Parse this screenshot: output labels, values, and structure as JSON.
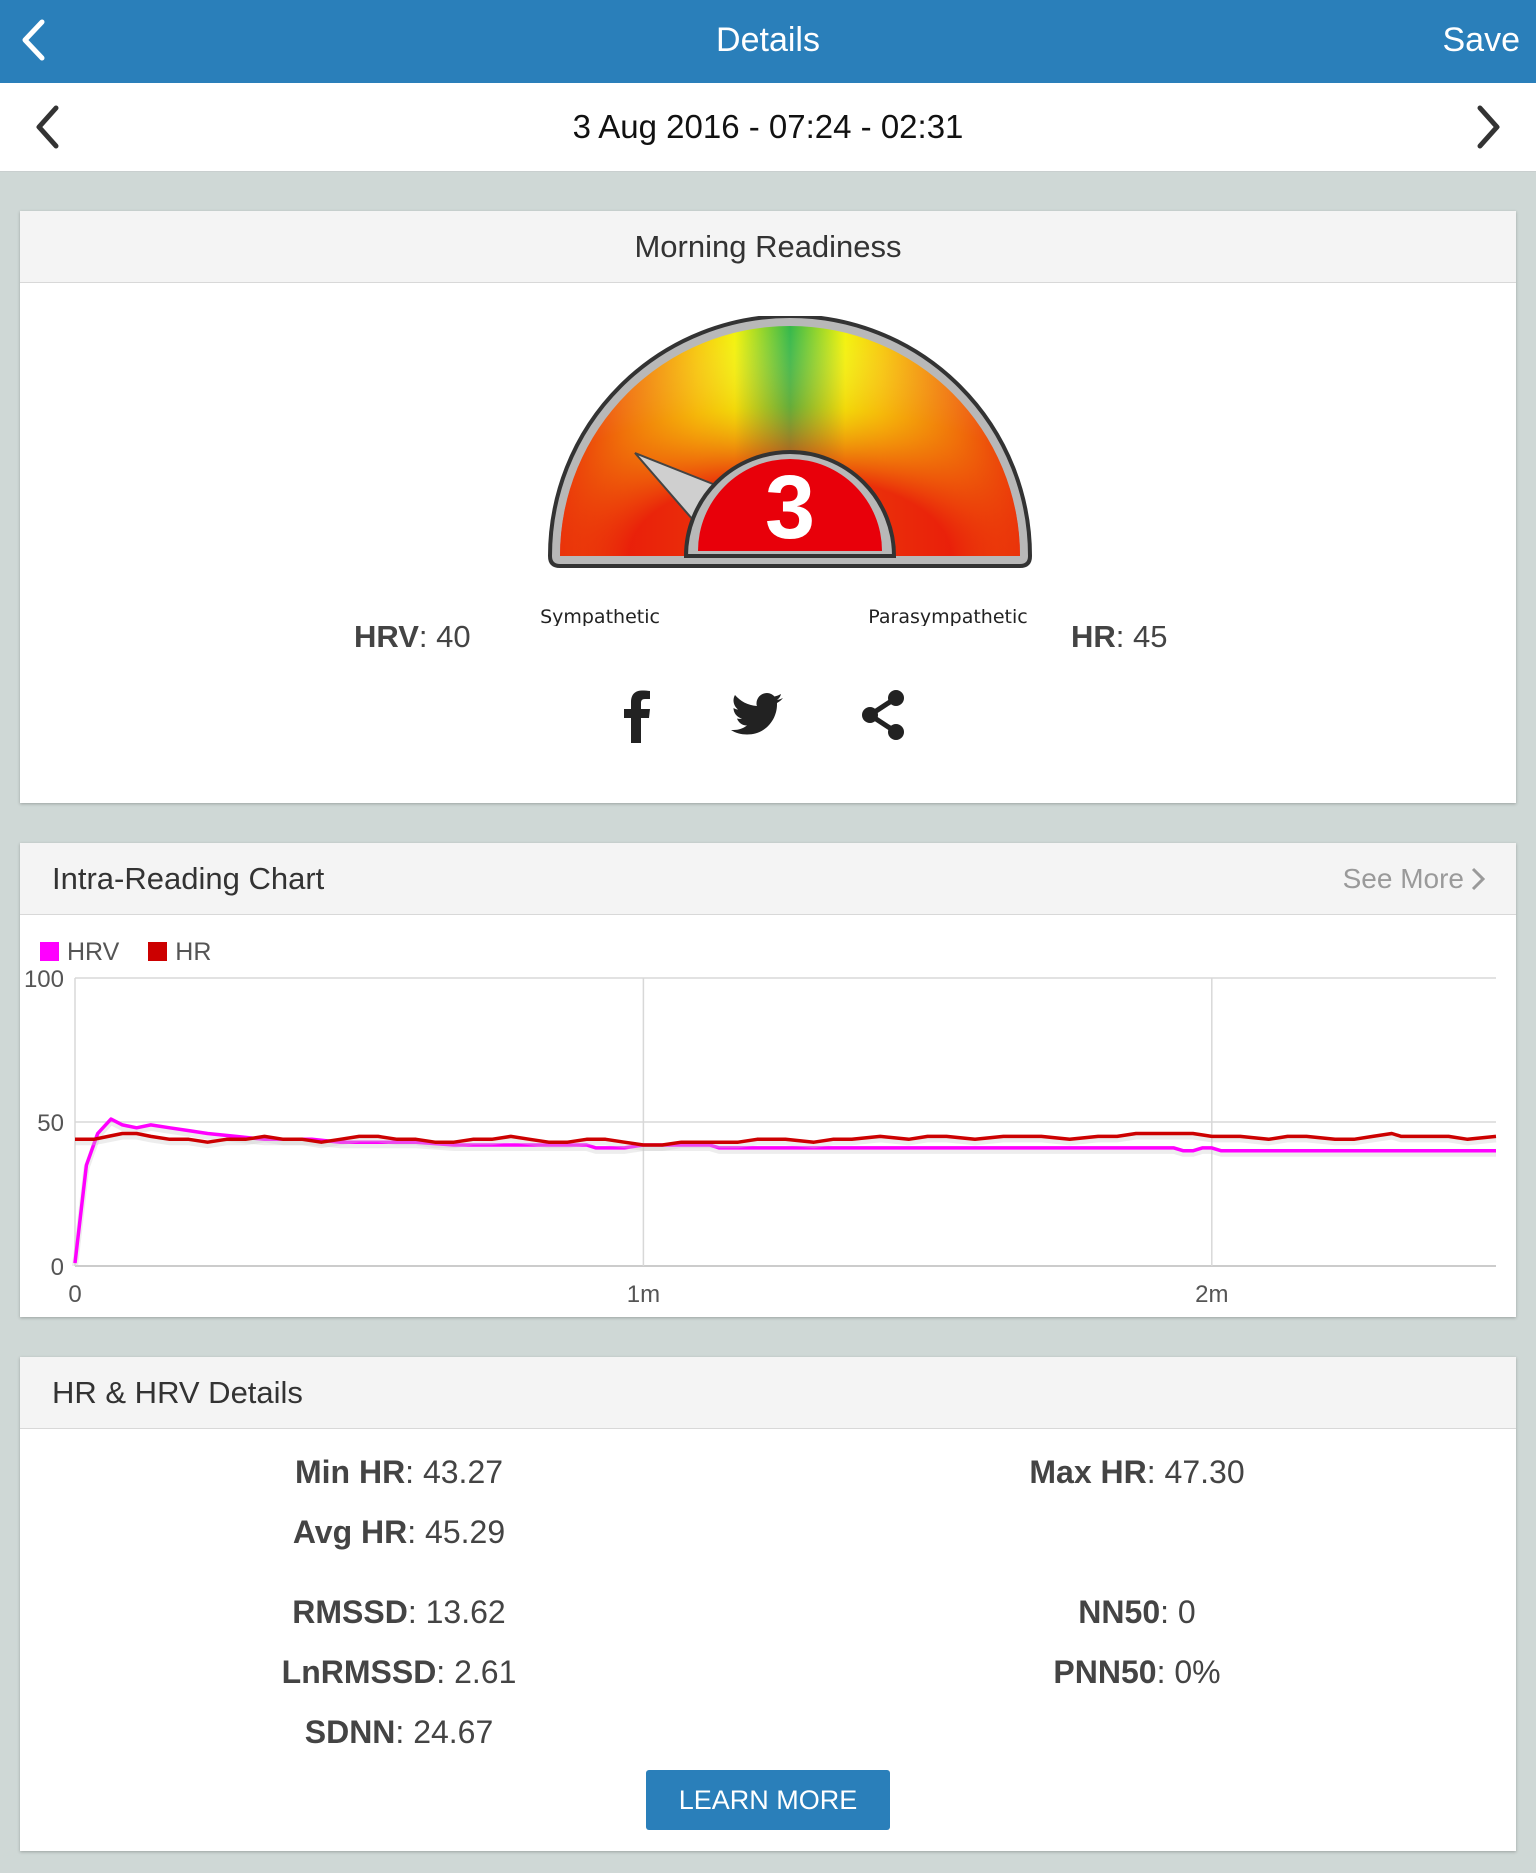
{
  "navbar": {
    "title": "Details",
    "save_label": "Save"
  },
  "datebar": {
    "date": "3 Aug 2016 - 07:24 - 02:31"
  },
  "readiness": {
    "title": "Morning Readiness",
    "score": "3",
    "left_label": "Sympathetic",
    "right_label": "Parasympathetic",
    "hrv_label": "HRV",
    "hrv_value": "40",
    "hr_label": "HR",
    "hr_value": "45",
    "needle_position": 0.22,
    "share_icons": [
      "facebook-icon",
      "twitter-icon",
      "share-icon"
    ],
    "colors": {
      "gauge_low": "#e8120a",
      "gauge_mid": "#f5f20a",
      "gauge_high": "#2fb44a",
      "score_bg": "#e8000a"
    }
  },
  "intra": {
    "title": "Intra-Reading Chart",
    "see_more": "See More"
  },
  "chart_data": {
    "type": "line",
    "xlabel": "",
    "ylabel": "",
    "x_unit": "seconds",
    "xlim": [
      0,
      150
    ],
    "ylim": [
      0,
      100
    ],
    "y_ticks": [
      "0",
      "50",
      "100"
    ],
    "x_ticks": [
      {
        "value": 0,
        "label": "0"
      },
      {
        "value": 60,
        "label": "1m"
      },
      {
        "value": 120,
        "label": "2m"
      }
    ],
    "grid": true,
    "legend": "top-left",
    "series": [
      {
        "name": "HRV",
        "color": "#ff00ff",
        "points": [
          [
            0,
            1
          ],
          [
            1.2,
            35
          ],
          [
            2.4,
            46
          ],
          [
            3.8,
            51
          ],
          [
            5,
            49
          ],
          [
            6.5,
            48
          ],
          [
            8,
            49
          ],
          [
            10,
            48
          ],
          [
            12,
            47
          ],
          [
            14,
            46
          ],
          [
            17,
            45
          ],
          [
            20,
            44
          ],
          [
            25,
            44
          ],
          [
            28,
            43
          ],
          [
            32,
            43
          ],
          [
            36,
            43
          ],
          [
            40,
            42
          ],
          [
            45,
            42
          ],
          [
            50,
            42
          ],
          [
            54,
            42
          ],
          [
            55,
            41
          ],
          [
            58,
            41
          ],
          [
            60,
            42
          ],
          [
            63,
            42
          ],
          [
            67,
            42
          ],
          [
            68,
            41
          ],
          [
            72,
            41
          ],
          [
            80,
            41
          ],
          [
            90,
            41
          ],
          [
            100,
            41
          ],
          [
            110,
            41
          ],
          [
            116,
            41
          ],
          [
            117,
            40
          ],
          [
            118,
            40
          ],
          [
            119,
            41
          ],
          [
            120,
            41
          ],
          [
            121,
            40
          ],
          [
            125,
            40
          ],
          [
            130,
            40
          ],
          [
            135,
            40
          ],
          [
            140,
            40
          ],
          [
            145,
            40
          ],
          [
            150,
            40
          ]
        ]
      },
      {
        "name": "HR",
        "color": "#cc0000",
        "points": [
          [
            0,
            44
          ],
          [
            2,
            44
          ],
          [
            3.5,
            45
          ],
          [
            5,
            46
          ],
          [
            6.5,
            46
          ],
          [
            8,
            45
          ],
          [
            10,
            44
          ],
          [
            12,
            44
          ],
          [
            14,
            43
          ],
          [
            16,
            44
          ],
          [
            18,
            44
          ],
          [
            20,
            45
          ],
          [
            22,
            44
          ],
          [
            24,
            44
          ],
          [
            26,
            43
          ],
          [
            28,
            44
          ],
          [
            30,
            45
          ],
          [
            32,
            45
          ],
          [
            34,
            44
          ],
          [
            36,
            44
          ],
          [
            38,
            43
          ],
          [
            40,
            43
          ],
          [
            42,
            44
          ],
          [
            44,
            44
          ],
          [
            46,
            45
          ],
          [
            48,
            44
          ],
          [
            50,
            43
          ],
          [
            52,
            43
          ],
          [
            54,
            44
          ],
          [
            56,
            44
          ],
          [
            58,
            43
          ],
          [
            60,
            42
          ],
          [
            62,
            42
          ],
          [
            64,
            43
          ],
          [
            67,
            43
          ],
          [
            70,
            43
          ],
          [
            72,
            44
          ],
          [
            75,
            44
          ],
          [
            78,
            43
          ],
          [
            80,
            44
          ],
          [
            82,
            44
          ],
          [
            85,
            45
          ],
          [
            88,
            44
          ],
          [
            90,
            45
          ],
          [
            92,
            45
          ],
          [
            95,
            44
          ],
          [
            98,
            45
          ],
          [
            100,
            45
          ],
          [
            102,
            45
          ],
          [
            105,
            44
          ],
          [
            108,
            45
          ],
          [
            110,
            45
          ],
          [
            112,
            46
          ],
          [
            115,
            46
          ],
          [
            118,
            46
          ],
          [
            120,
            45
          ],
          [
            123,
            45
          ],
          [
            126,
            44
          ],
          [
            128,
            45
          ],
          [
            130,
            45
          ],
          [
            133,
            44
          ],
          [
            135,
            44
          ],
          [
            137,
            45
          ],
          [
            139,
            46
          ],
          [
            140,
            45
          ],
          [
            142,
            45
          ],
          [
            145,
            45
          ],
          [
            147,
            44
          ],
          [
            150,
            45
          ]
        ]
      }
    ]
  },
  "details": {
    "title": "HR & HRV Details",
    "rows": [
      {
        "label": "Min HR",
        "value": "43.27"
      },
      {
        "label": "Max HR",
        "value": "47.30"
      },
      {
        "label": "Avg HR",
        "value": "45.29"
      },
      {
        "label": "RMSSD",
        "value": "13.62"
      },
      {
        "label": "NN50",
        "value": "0"
      },
      {
        "label": "LnRMSSD",
        "value": "2.61"
      },
      {
        "label": "PNN50",
        "value": "0%"
      },
      {
        "label": "SDNN",
        "value": "24.67"
      }
    ],
    "learn_more": "LEARN MORE"
  }
}
